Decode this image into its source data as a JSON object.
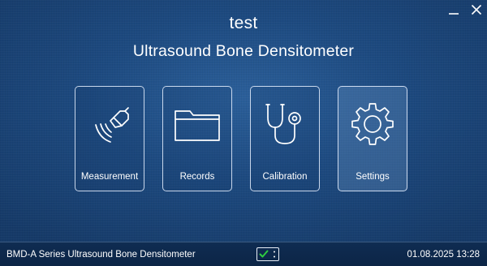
{
  "header": {
    "title": "test",
    "subtitle": "Ultrasound Bone Densitometer"
  },
  "window_controls": {
    "minimize_icon": "minimize-icon",
    "close_icon": "close-icon"
  },
  "tiles": [
    {
      "label": "Measurement",
      "icon": "ultrasound-probe-icon",
      "active": false
    },
    {
      "label": "Records",
      "icon": "folder-icon",
      "active": false
    },
    {
      "label": "Calibration",
      "icon": "stethoscope-icon",
      "active": false
    },
    {
      "label": "Settings",
      "icon": "gear-icon",
      "active": true
    }
  ],
  "footer": {
    "product_name": "BMD-A Series Ultrasound Bone Densitometer",
    "datetime": "01.08.2025 13:28",
    "device_status_icon": "device-connected-check-icon",
    "check_color": "#2ecc40"
  },
  "colors": {
    "background": "#1d4a80",
    "footer": "#0f2c52",
    "text": "#ffffff"
  }
}
